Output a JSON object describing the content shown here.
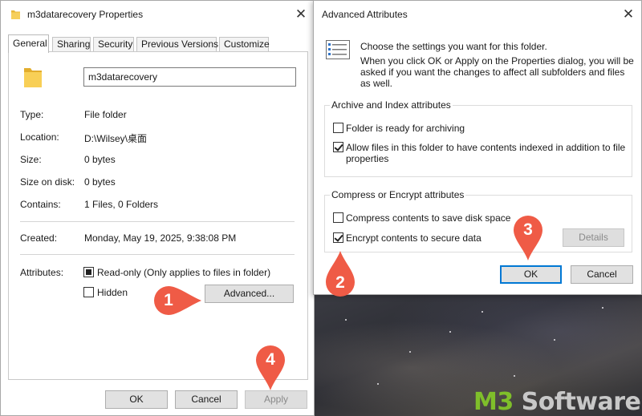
{
  "properties": {
    "title": "m3datarecovery Properties",
    "close_glyph": "✕",
    "tabs": [
      "General",
      "Sharing",
      "Security",
      "Previous Versions",
      "Customize"
    ],
    "name_value": "m3datarecovery",
    "fields": {
      "type_label": "Type:",
      "type_value": "File folder",
      "location_label": "Location:",
      "location_value": "D:\\Wilsey\\桌面",
      "size_label": "Size:",
      "size_value": "0 bytes",
      "size_on_disk_label": "Size on disk:",
      "size_on_disk_value": "0 bytes",
      "contains_label": "Contains:",
      "contains_value": "1 Files, 0 Folders",
      "created_label": "Created:",
      "created_value": "Monday, May 19, 2025, 9:38:08 PM",
      "attributes_label": "Attributes:"
    },
    "attributes": {
      "readonly_label": "Read-only (Only applies to files in folder)",
      "readonly_state": "indeterminate",
      "hidden_label": "Hidden",
      "hidden_state": "unchecked",
      "advanced_button": "Advanced..."
    },
    "buttons": {
      "ok": "OK",
      "cancel": "Cancel",
      "apply": "Apply"
    }
  },
  "advanced": {
    "title": "Advanced Attributes",
    "close_glyph": "✕",
    "description_line1": "Choose the settings you want for this folder.",
    "description_line2": "When you click OK or Apply on the Properties dialog, you will be",
    "description_line3": "asked if you want the changes to affect all subfolders and files",
    "description_line4": "as well.",
    "archive_group": {
      "title": "Archive and Index attributes",
      "archiving_label": "Folder is ready for archiving",
      "archiving_state": "unchecked",
      "index_label_line1": "Allow files in this folder to have contents indexed in addition to file",
      "index_label_line2": "properties",
      "index_state": "checked"
    },
    "compress_group": {
      "title": "Compress or Encrypt attributes",
      "compress_label": "Compress contents to save disk space",
      "compress_state": "unchecked",
      "encrypt_label": "Encrypt contents to secure data",
      "encrypt_state": "checked",
      "details_button": "Details"
    },
    "buttons": {
      "ok": "OK",
      "cancel": "Cancel"
    }
  },
  "step_markers": [
    "1",
    "2",
    "3",
    "4"
  ],
  "marker_color": "#ef5b46",
  "watermark": {
    "part1": "M3",
    "part2": " Software"
  }
}
